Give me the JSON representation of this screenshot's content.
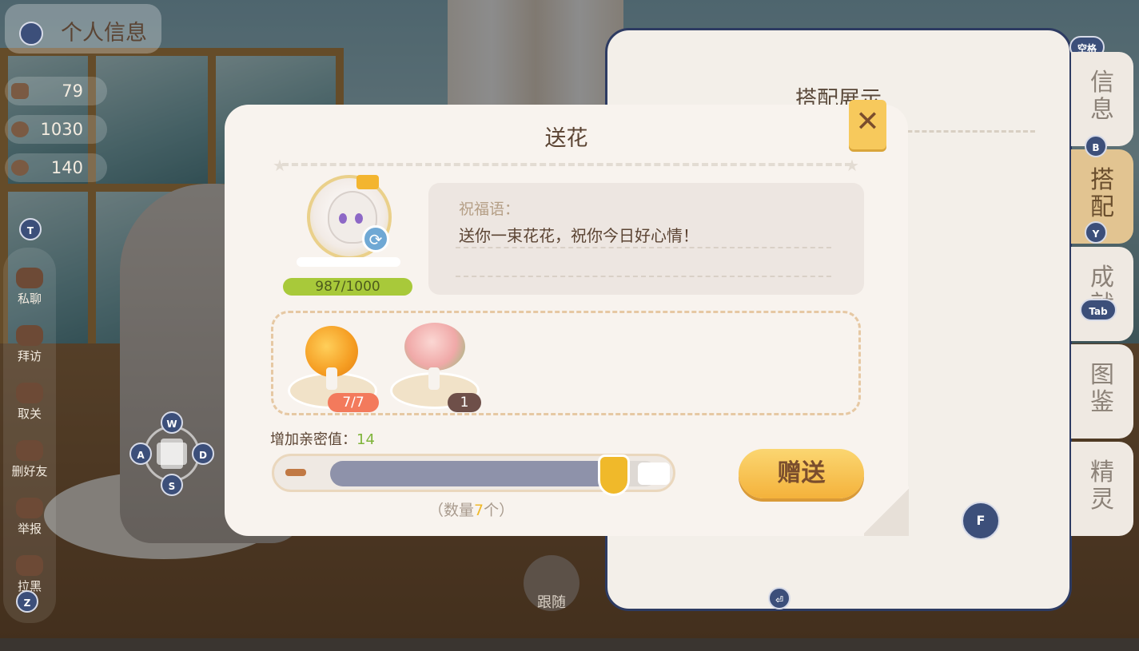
{
  "hud": {
    "profile_title": "个人信息",
    "stats": [
      {
        "icon": "bear-icon",
        "value": "79"
      },
      {
        "icon": "moon-icon",
        "value": "1030"
      },
      {
        "icon": "cookie-icon",
        "value": "140"
      }
    ],
    "keys": {
      "t": "T",
      "z": "Z",
      "f": "F",
      "space": "空格",
      "b": "B",
      "y": "Y",
      "tab": "Tab",
      "enter": "⏎"
    },
    "menu": [
      {
        "icon": "chat-icon",
        "label": "私聊"
      },
      {
        "icon": "house-icon",
        "label": "拜访"
      },
      {
        "icon": "heart-broken-icon",
        "label": "取关"
      },
      {
        "icon": "remove-friend-icon",
        "label": "删好友"
      },
      {
        "icon": "report-icon",
        "label": "举报"
      },
      {
        "icon": "block-icon",
        "label": "拉黑"
      }
    ],
    "dpad": {
      "up": "W",
      "left": "A",
      "right": "D",
      "down": "S"
    },
    "follow_label": "跟随"
  },
  "right_panel": {
    "title": "搭配展示",
    "tabs": [
      "信息",
      "搭配",
      "成就",
      "图鉴",
      "精灵"
    ],
    "active_tab": "搭配"
  },
  "dialog": {
    "title": "送花",
    "favor": "987/1000",
    "blessing_label": "祝福语：",
    "blessing_text": "送你一束花花，祝你今日好心情！",
    "flowers": [
      {
        "name": "orange-bouquet",
        "count": "7/7",
        "badge_color": "#f37a5c"
      },
      {
        "name": "pink-bouquet",
        "count": "1",
        "badge_color": "#6e4f49"
      }
    ],
    "affinity_label": "增加亲密值：",
    "affinity_value": "14",
    "slider": {
      "value": 7,
      "max": 7,
      "fill_fraction": 0.87
    },
    "qty_prefix": "（数量",
    "qty_value": "7",
    "qty_suffix": "个）",
    "give_label": "赠送",
    "close_symbol": "✕"
  },
  "colors": {
    "accent_yellow": "#f4b23b",
    "favor_green": "#a8c93a",
    "affinity_green": "#7fb43a",
    "dialog_bg": "#f8f3ee"
  }
}
